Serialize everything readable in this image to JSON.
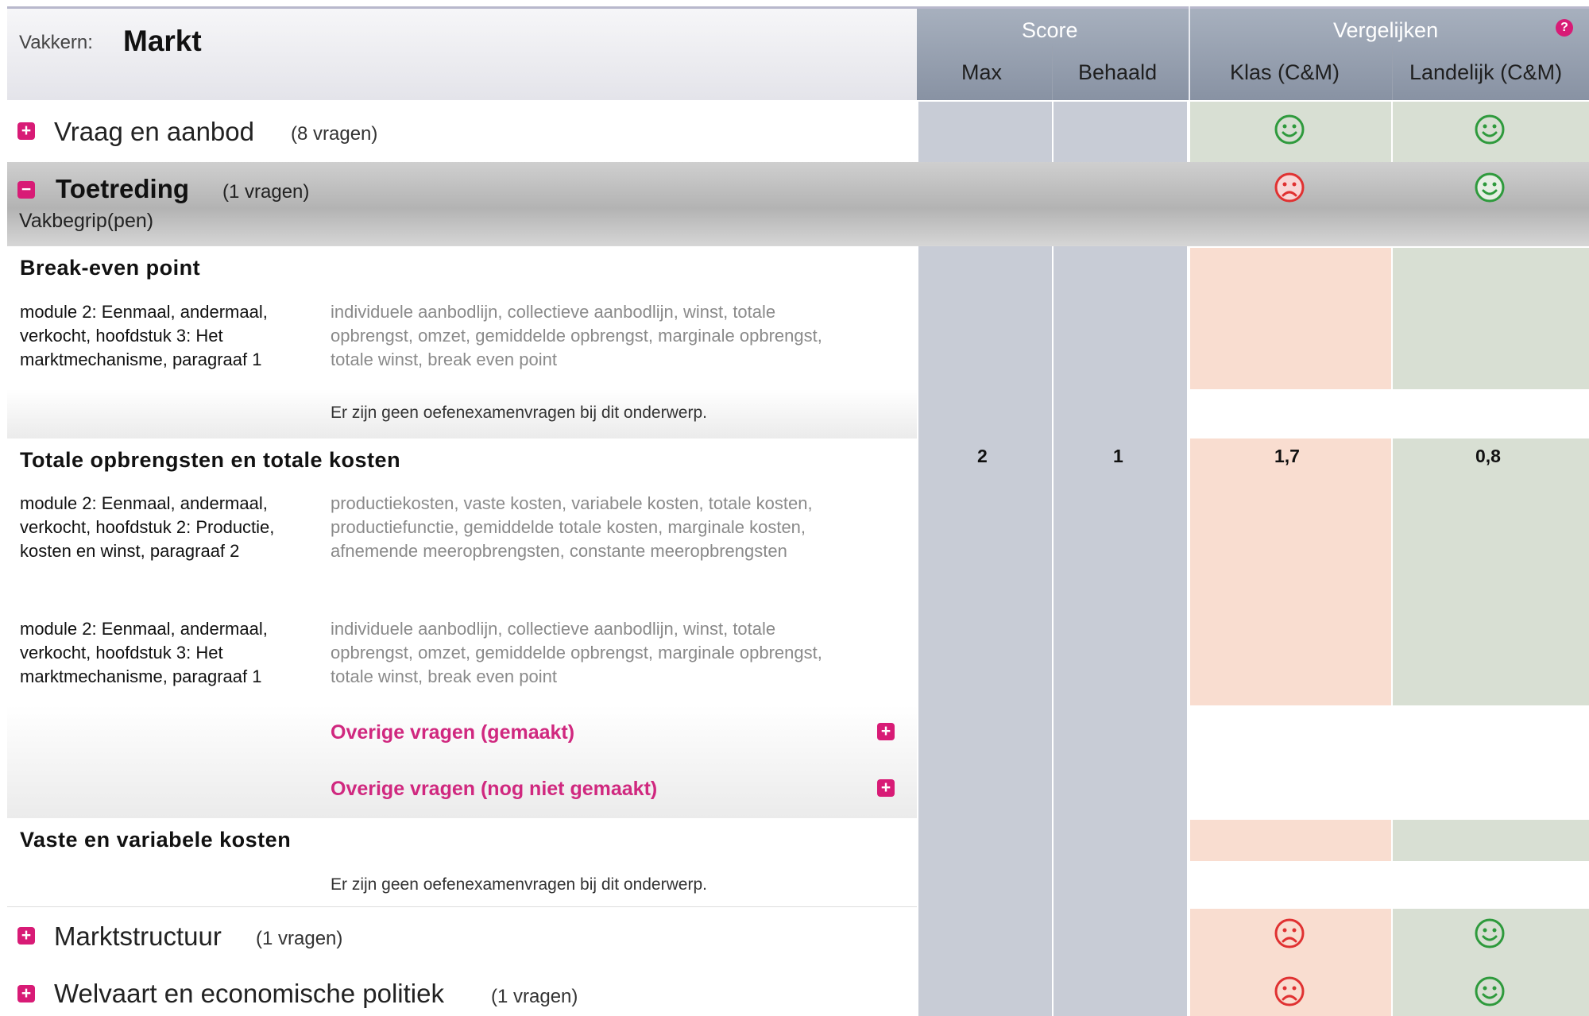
{
  "header": {
    "vakkern_label": "Vakkern:",
    "vakkern_value": "Markt",
    "score_label": "Score",
    "vergelijken_label": "Vergelijken",
    "help_icon": "question-icon",
    "columns": {
      "max": "Max",
      "behaald": "Behaald",
      "klas": "Klas (C&M)",
      "landelijk": "Landelijk (C&M)"
    }
  },
  "rows": {
    "vraag": {
      "title": "Vraag en aanbod",
      "count": "(8 vragen)",
      "klas_icon": "smiley-happy",
      "landelijk_icon": "smiley-happy"
    },
    "toetreding": {
      "title": "Toetreding",
      "count": "(1 vragen)",
      "subtitle": "Vakbegrip(pen)",
      "klas_icon": "smiley-sad",
      "landelijk_icon": "smiley-happy",
      "max": "2",
      "behaald": "1",
      "klas": "1,7",
      "landelijk": "0,8"
    },
    "marktstructuur": {
      "title": "Marktstructuur",
      "count": "(1 vragen)",
      "klas_icon": "smiley-sad",
      "landelijk_icon": "smiley-happy"
    },
    "welvaart": {
      "title": "Welvaart en economische politiek",
      "count": "(1 vragen)",
      "klas_icon": "smiley-sad",
      "landelijk_icon": "smiley-happy"
    }
  },
  "topics": {
    "breakeven": {
      "title": "Break-even point",
      "module": "module 2: Eenmaal, andermaal, verkocht, hoofdstuk 3: Het marktmechanisme, paragraaf 1",
      "keywords": "individuele aanbodlijn, collectieve aanbodlijn, winst, totale opbrengst, omzet, gemiddelde opbrengst, marginale opbrengst, totale winst, break even point",
      "note": "Er zijn geen oefenexamenvragen bij dit onderwerp."
    },
    "totale": {
      "title": "Totale opbrengsten en totale kosten",
      "module1": "module 2: Eenmaal, andermaal, verkocht, hoofdstuk 2: Productie, kosten en winst, paragraaf 2",
      "keywords1": "productiekosten, vaste kosten, variabele kosten, totale kosten, productiefunctie, gemiddelde totale kosten, marginale kosten, afnemende meeropbrengsten, constante meeropbrengsten",
      "module2": "module 2: Eenmaal, andermaal, verkocht, hoofdstuk 3: Het marktmechanisme, paragraaf 1",
      "keywords2": "individuele aanbodlijn, collectieve aanbodlijn, winst, totale opbrengst, omzet, gemiddelde opbrengst, marginale opbrengst, totale winst, break even point",
      "overige_gemaakt": "Overige vragen (gemaakt)",
      "overige_niet": "Overige vragen (nog niet gemaakt)"
    },
    "vaste": {
      "title": "Vaste en variabele kosten",
      "note": "Er zijn geen oefenexamenvragen bij dit onderwerp."
    }
  },
  "colors": {
    "accent": "#d81b76",
    "happy": "#2e9a3c",
    "sad": "#e03131"
  }
}
